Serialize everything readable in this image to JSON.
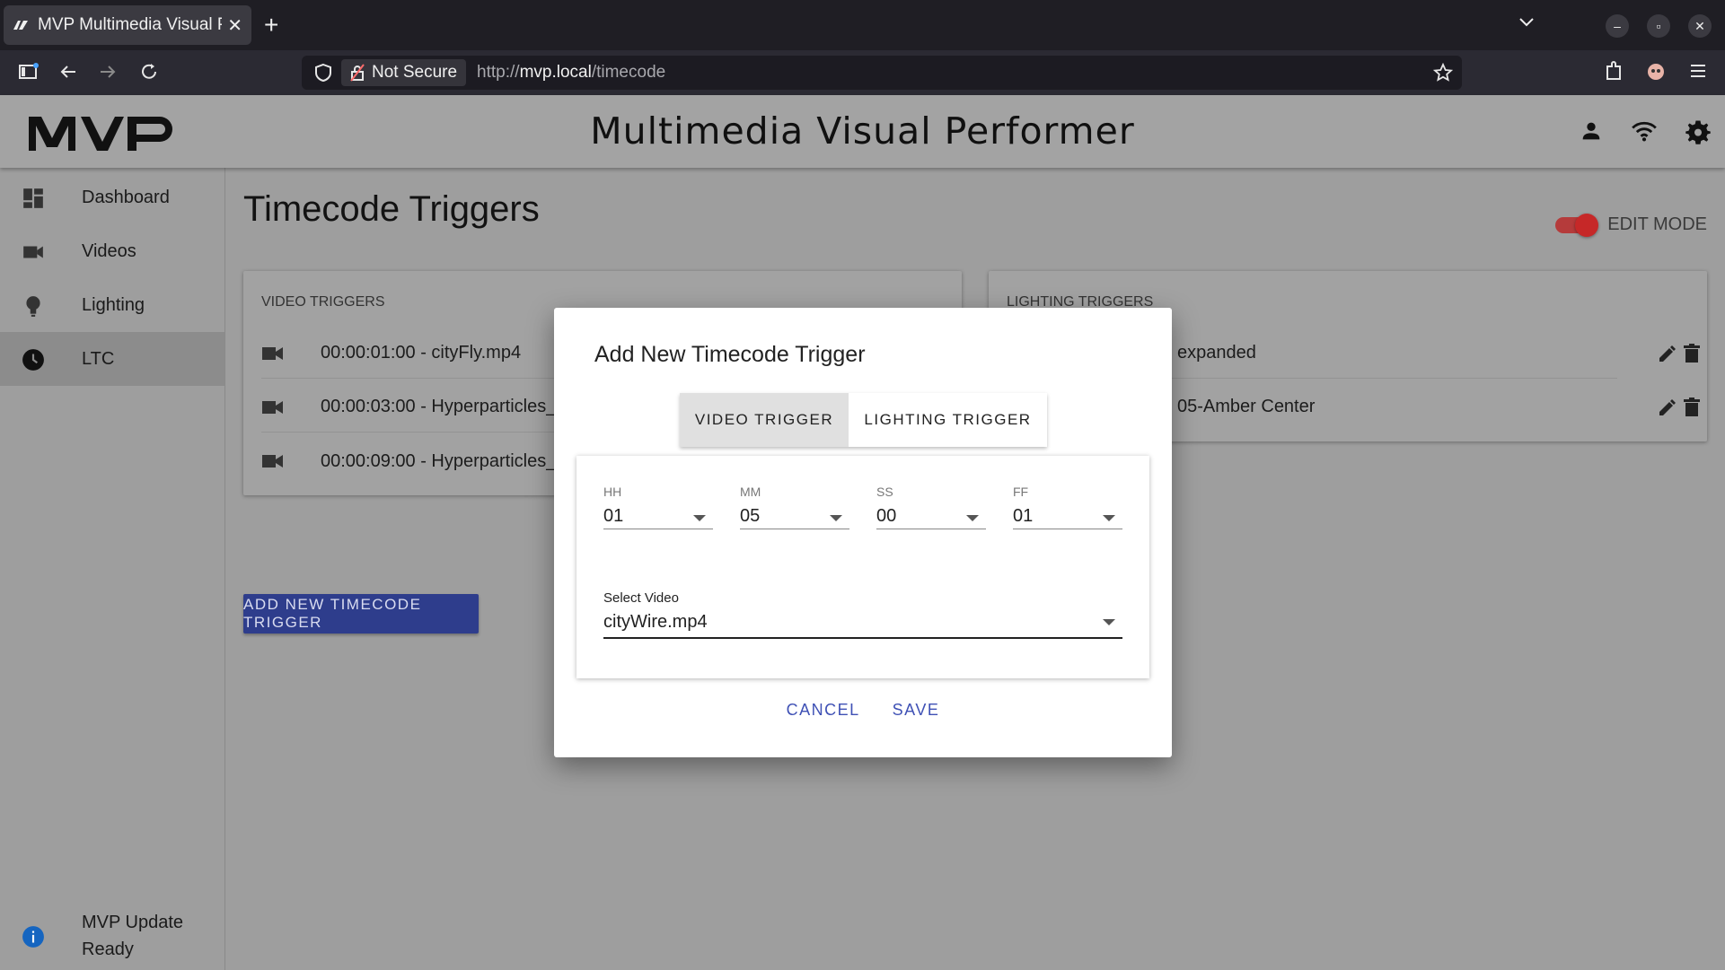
{
  "browser": {
    "tab_title": "MVP Multimedia Visual P",
    "not_secure_label": "Not Secure",
    "url_prefix": "http://",
    "url_host": "mvp.local",
    "url_path": "/timecode"
  },
  "app": {
    "title": "Multimedia Visual Performer",
    "logo_text": "MVP"
  },
  "sidebar": {
    "items": [
      {
        "label": "Dashboard",
        "icon": "dashboard-icon"
      },
      {
        "label": "Videos",
        "icon": "videocam-icon"
      },
      {
        "label": "Lighting",
        "icon": "lightbulb-icon"
      },
      {
        "label": "LTC",
        "icon": "clock-icon"
      }
    ],
    "update_label": "MVP Update Ready"
  },
  "page": {
    "title": "Timecode Triggers",
    "edit_mode_label": "EDIT MODE",
    "edit_mode_on": true,
    "add_button_label": "ADD NEW TIMECODE TRIGGER"
  },
  "video_triggers": {
    "title": "VIDEO TRIGGERS",
    "rows": [
      "00:00:01:00 - cityFly.mp4",
      "00:00:03:00 - Hyperparticles_",
      "00:00:09:00 - Hyperparticles_"
    ]
  },
  "lighting_triggers": {
    "title": "LIGHTING TRIGGERS",
    "rows": [
      "expanded",
      "05-Amber Center"
    ]
  },
  "dialog": {
    "title": "Add New Timecode Trigger",
    "tab_video": "VIDEO TRIGGER",
    "tab_lighting": "LIGHTING TRIGGER",
    "fields": [
      {
        "label": "HH",
        "value": "01"
      },
      {
        "label": "MM",
        "value": "05"
      },
      {
        "label": "SS",
        "value": "00"
      },
      {
        "label": "FF",
        "value": "01"
      }
    ],
    "video_label": "Select Video",
    "video_value": "cityWire.mp4",
    "cancel_label": "CANCEL",
    "save_label": "SAVE"
  },
  "colors": {
    "primary": "#2e3d8c",
    "accent": "#c62828",
    "link": "#3f51b5"
  }
}
